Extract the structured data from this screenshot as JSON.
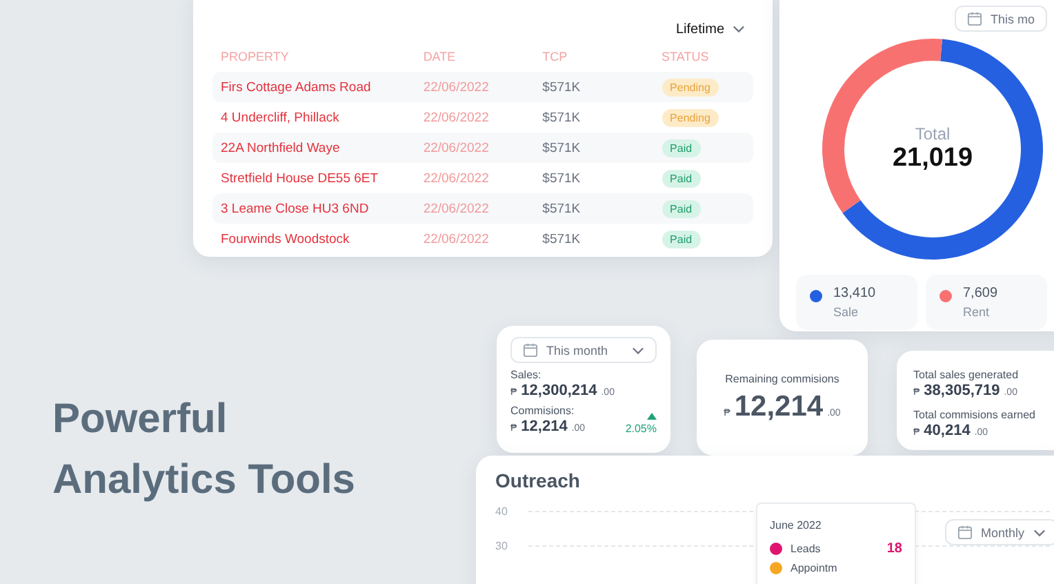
{
  "headline": "Powerful Analytics Tools",
  "properties_table": {
    "period": "Lifetime",
    "columns": [
      "PROPERTY",
      "DATE",
      "TCP",
      "STATUS"
    ],
    "rows": [
      {
        "property": "Firs Cottage Adams Road",
        "date": "22/06/2022",
        "tcp": "$571K",
        "status": {
          "text": "Pending",
          "kind": "pending"
        }
      },
      {
        "property": "4 Undercliff, Phillack",
        "date": "22/06/2022",
        "tcp": "$571K",
        "status": {
          "text": "Pending",
          "kind": "pending"
        }
      },
      {
        "property": "22A Northfield Waye",
        "date": "22/06/2022",
        "tcp": "$571K",
        "status": {
          "text": "Paid",
          "kind": "paid"
        }
      },
      {
        "property": "Stretfield House DE55 6ET",
        "date": "22/06/2022",
        "tcp": "$571K",
        "status": {
          "text": "Paid",
          "kind": "paid"
        }
      },
      {
        "property": "3 Leame Close HU3 6ND",
        "date": "22/06/2022",
        "tcp": "$571K",
        "status": {
          "text": "Paid",
          "kind": "paid"
        }
      },
      {
        "property": "Fourwinds Woodstock",
        "date": "22/06/2022",
        "tcp": "$571K",
        "status": {
          "text": "Paid",
          "kind": "paid"
        }
      }
    ]
  },
  "totals_card": {
    "period": "This mo",
    "center_label": "Total",
    "total": "21,019",
    "chart_data": {
      "type": "donut",
      "categories": [
        "Sale",
        "Rent"
      ],
      "values": [
        63.8,
        36.2
      ]
    },
    "legend": [
      {
        "value": "13,410",
        "color": "#2560e0"
      },
      {
        "value": "7,609",
        "color": "#f87171"
      }
    ]
  },
  "sales_card": {
    "period": "This month",
    "metrics": [
      {
        "label": "Sales:",
        "currency": "₱",
        "amount": "12,300,214",
        "cents": ".00"
      },
      {
        "label": "Commisions:",
        "currency": "₱",
        "amount": "12,214",
        "cents": ".00",
        "change": "2.05%"
      }
    ]
  },
  "remaining_card": {
    "label": "Remaining commisions",
    "currency": "₱",
    "amount": "12,214",
    "cents": ".00"
  },
  "totals_summary": [
    {
      "label": "Total sales generated",
      "currency": "₱",
      "amount": "38,305,719",
      "cents": ".00"
    },
    {
      "label": "Total commisions earned",
      "currency": "₱",
      "amount": "40,214",
      "cents": ".00"
    }
  ],
  "outreach": {
    "title": "Outreach",
    "period": "Monthly",
    "y_ticks": [
      "40",
      "30"
    ],
    "tooltip": {
      "date": "June 2022",
      "items": [
        {
          "label": "Leads",
          "color": "#e0146e",
          "value": "18"
        },
        {
          "label": "Appointm",
          "color": "#f5a623"
        }
      ]
    }
  }
}
